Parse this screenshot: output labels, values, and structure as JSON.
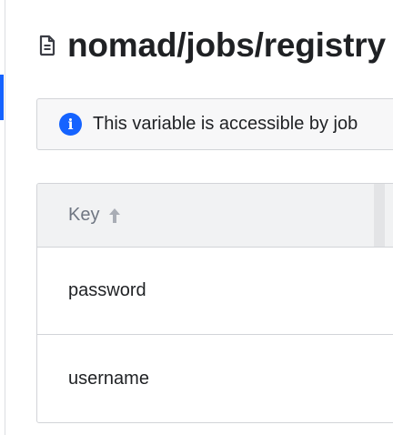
{
  "page": {
    "title": "nomad/jobs/registry",
    "title_icon": "file-text-icon"
  },
  "notice": {
    "icon": "info-icon",
    "text": "This variable is accessible by job"
  },
  "table": {
    "columns": [
      {
        "label": "Key",
        "sort": "ascending",
        "sort_icon": "arrow-up-icon"
      }
    ],
    "rows": [
      {
        "key": "password"
      },
      {
        "key": "username"
      }
    ]
  },
  "colors": {
    "accent": "#1563ff",
    "text": "#1f2124",
    "muted": "#6f7682",
    "border": "#d2d4d8",
    "header_bg": "#f1f2f3"
  }
}
